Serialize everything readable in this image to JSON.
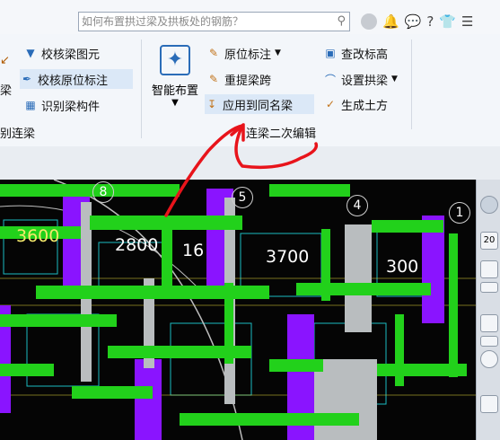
{
  "search": {
    "placeholder": "如何布置拱过梁及拱板处的钢筋？"
  },
  "ribbon": {
    "left_cut": {
      "top": "0",
      "middle": "梁"
    },
    "check": [
      "校核梁图元",
      "校核原位标注",
      "识别梁构件"
    ],
    "smart": "智能布置",
    "group1": "别连梁",
    "edit": [
      "原位标注",
      "重提梁跨",
      "应用到同名梁"
    ],
    "right": [
      "查改标高",
      "设置拱梁",
      "生成土方"
    ],
    "group2": "连梁二次编辑"
  },
  "labels": {
    "beam_3600": "3600",
    "beam_2800": "2800",
    "beam_16": "16",
    "beam_3700": "3700",
    "beam_300": "300"
  },
  "axes": {
    "a8": "8",
    "a5": "5",
    "a4": "4",
    "a1": "1"
  },
  "panel": {
    "zoom": "20"
  },
  "colors": {
    "annotation": "#e8141b",
    "beam_green": "#22d11b",
    "wall_purple": "#8a14ff",
    "column_gray": "#b9bdbf"
  }
}
